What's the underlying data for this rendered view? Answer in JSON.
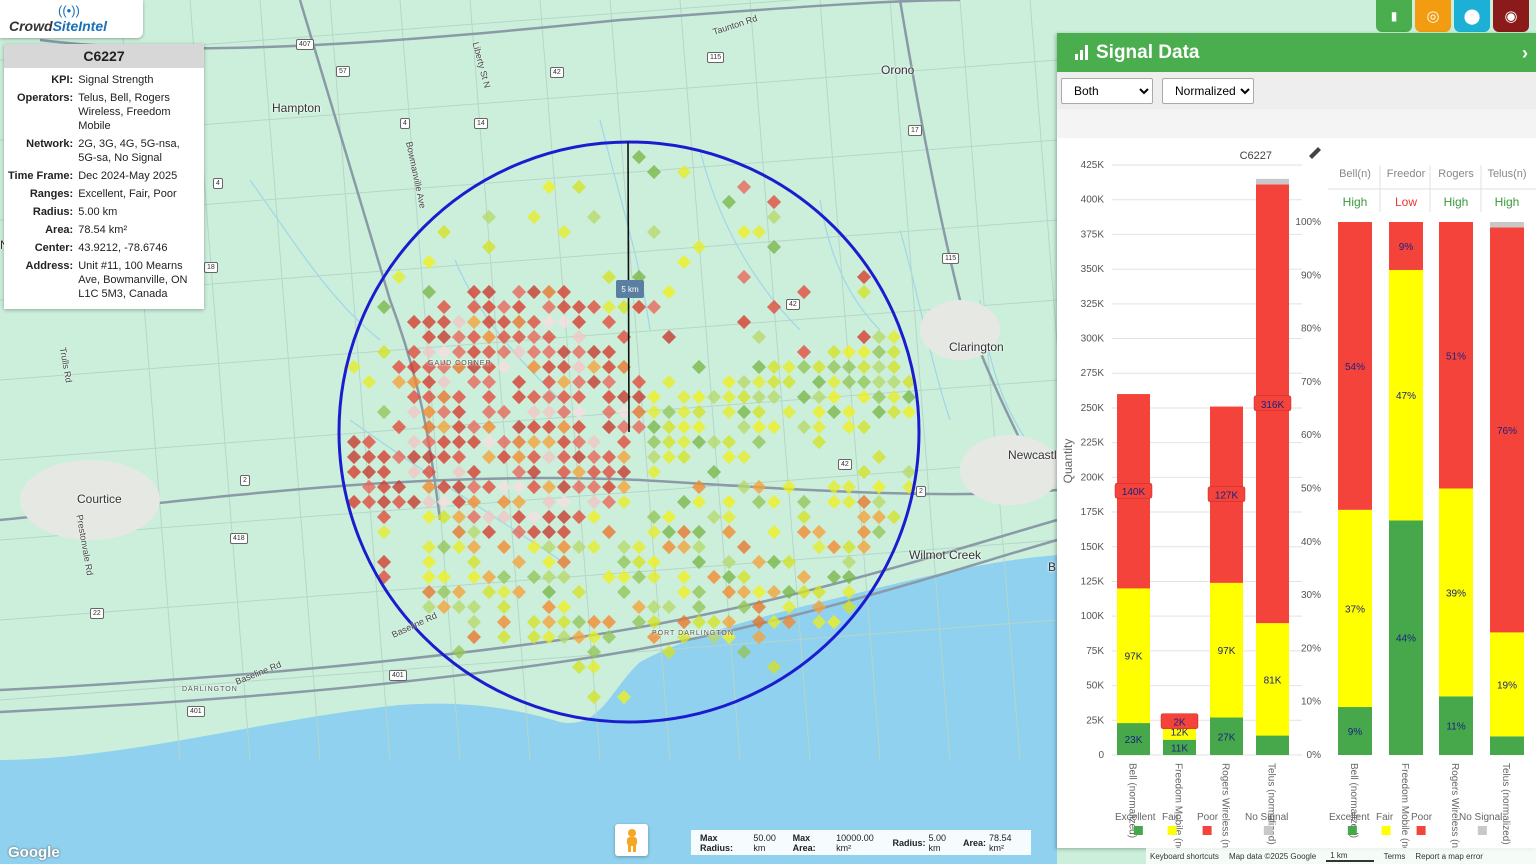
{
  "logo": {
    "brand_part1": "Crowd",
    "brand_part2": "SiteIntel"
  },
  "info": {
    "title": "C6227",
    "rows": [
      {
        "label": "KPI:",
        "value": "Signal Strength"
      },
      {
        "label": "Operators:",
        "value": "Telus, Bell, Rogers Wireless, Freedom Mobile"
      },
      {
        "label": "Network:",
        "value": "2G, 3G, 4G, 5G-nsa, 5G-sa, No Signal"
      },
      {
        "label": "Time Frame:",
        "value": "Dec 2024-May 2025"
      },
      {
        "label": "Ranges:",
        "value": "Excellent, Fair, Poor"
      },
      {
        "label": "Radius:",
        "value": "5.00 km"
      },
      {
        "label": "Area:",
        "value": "78.54 km²"
      },
      {
        "label": "Center:",
        "value": "43.9212, -78.6746"
      },
      {
        "label": "Address:",
        "value": "Unit #11, 100 Mearns Ave, Bowmanville, ON L1C 5M3, Canada"
      }
    ]
  },
  "toolbar": {
    "buttons": [
      {
        "name": "chart-button",
        "icon": "bar-chart-icon",
        "color": "#4aad4e"
      },
      {
        "name": "target-button",
        "icon": "target-icon",
        "color": "#f39c12"
      },
      {
        "name": "location-button",
        "icon": "map-pin-icon",
        "color": "#1db0d6"
      },
      {
        "name": "globe-button",
        "icon": "globe-icon",
        "color": "#8b1a1a"
      }
    ]
  },
  "map": {
    "places": [
      "Hampton",
      "Orono",
      "Clarington",
      "Newcastl",
      "Courtice",
      "Wilmot Creek",
      "B",
      "GAUD CORNER",
      "PORT DARLINGTON",
      "DARLINGTON",
      "N"
    ],
    "roads": [
      "Taunton Rd",
      "Liberty St N",
      "Bowmanville Ave",
      "Trulls Rd",
      "Prestonvale Rd",
      "Baseline Rd",
      "Baseline Rd"
    ],
    "shields": [
      "407",
      "57",
      "42",
      "115",
      "4",
      "14",
      "4",
      "17",
      "18",
      "115",
      "42",
      "2",
      "418",
      "22",
      "401",
      "401",
      "42",
      "2"
    ],
    "radius_label": "5 km",
    "colors": {
      "circle": "#1c1ccf",
      "water": "#8fd1ef",
      "land": "#ccefdc"
    }
  },
  "panel": {
    "title": "Signal Data",
    "select_operator": "Both",
    "select_mode": "Normalized",
    "chart_title": "C6227"
  },
  "chart_data": [
    {
      "type": "bar",
      "stacked": true,
      "title": "C6227",
      "ylabel": "Quantity",
      "ylim": [
        0,
        425000
      ],
      "yticks": [
        "0",
        "25K",
        "50K",
        "75K",
        "100K",
        "125K",
        "150K",
        "175K",
        "200K",
        "225K",
        "250K",
        "275K",
        "300K",
        "325K",
        "350K",
        "375K",
        "400K",
        "425K"
      ],
      "categories": [
        "Bell (normalized)",
        "Freedom Mobile (normalized)",
        "Rogers Wireless (normalized)",
        "Telus (normalized)"
      ],
      "series": [
        {
          "name": "Excellent",
          "color": "#46a84a",
          "values": [
            23000,
            11000,
            27000,
            14000
          ],
          "labels": [
            "23K",
            "11K",
            "27K",
            ""
          ]
        },
        {
          "name": "Fair",
          "color": "#ffff00",
          "values": [
            97000,
            12000,
            97000,
            81000
          ],
          "labels": [
            "97K",
            "12K",
            "97K",
            "81K"
          ]
        },
        {
          "name": "Poor",
          "color": "#f4433b",
          "values": [
            140000,
            2000,
            127000,
            316000
          ],
          "labels": [
            "140K",
            "2K",
            "127K",
            "316K"
          ]
        },
        {
          "name": "No Signal",
          "color": "#c8c8c8",
          "values": [
            0,
            0,
            0,
            4000
          ],
          "labels": [
            "",
            "",
            "",
            ""
          ]
        }
      ]
    },
    {
      "type": "bar",
      "stacked": true,
      "ylim": [
        0,
        100
      ],
      "yticks": [
        "0%",
        "10%",
        "20%",
        "30%",
        "40%",
        "50%",
        "60%",
        "70%",
        "80%",
        "90%",
        "100%"
      ],
      "categories": [
        "Bell (normalized)",
        "Freedom Mobile (normalized)",
        "Rogers Wireless (normalized)",
        "Telus (normalized)"
      ],
      "column_headers": [
        "Bell(n)",
        "Freedor",
        "Rogers",
        "Telus(n)"
      ],
      "ratings": [
        {
          "text": "High",
          "color": "#3a9a3e"
        },
        {
          "text": "Low",
          "color": "#e53935"
        },
        {
          "text": "High",
          "color": "#3a9a3e"
        },
        {
          "text": "High",
          "color": "#3a9a3e"
        }
      ],
      "series": [
        {
          "name": "Excellent",
          "color": "#46a84a",
          "values": [
            9,
            44,
            11,
            3.5
          ],
          "labels": [
            "9%",
            "44%",
            "11%",
            ""
          ]
        },
        {
          "name": "Fair",
          "color": "#ffff00",
          "values": [
            37,
            47,
            39,
            19.5
          ],
          "labels": [
            "37%",
            "47%",
            "39%",
            "19%"
          ]
        },
        {
          "name": "Poor",
          "color": "#f4433b",
          "values": [
            54,
            9,
            50,
            76
          ],
          "labels": [
            "54%",
            "9%",
            "51%",
            "76%"
          ]
        },
        {
          "name": "No Signal",
          "color": "#c8c8c8",
          "values": [
            0,
            0,
            0,
            1
          ],
          "labels": [
            "",
            "",
            "",
            ""
          ]
        }
      ]
    }
  ],
  "legend": [
    {
      "name": "Excellent",
      "color": "#46a84a"
    },
    {
      "name": "Fair",
      "color": "#ffff00"
    },
    {
      "name": "Poor",
      "color": "#f4433b"
    },
    {
      "name": "No Signal",
      "color": "#c8c8c8"
    }
  ],
  "bottom": {
    "max_radius_label": "Max Radius:",
    "max_radius_value": "50.00 km",
    "max_area_label": "Max Area:",
    "max_area_value": "10000.00 km²",
    "radius_label": "Radius:",
    "radius_value": "5.00 km",
    "area_label": "Area:",
    "area_value": "78.54 km²",
    "google": "Google",
    "attrib": [
      "Keyboard shortcuts",
      "Map data ©2025 Google",
      "1 km",
      "Terms",
      "Report a map error"
    ]
  }
}
